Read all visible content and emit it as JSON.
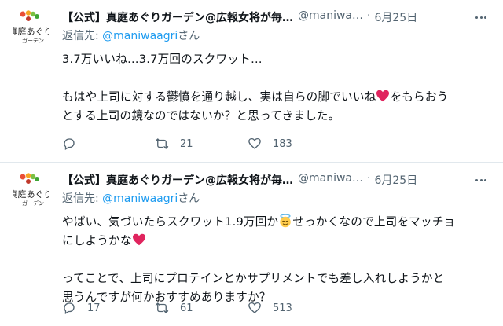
{
  "tweets": [
    {
      "display_name": "【公式】真庭あぐりガーデン@広報女将が毎…",
      "handle": "@maniwa…",
      "separator": "·",
      "date": "6月25日",
      "reply_prefix": "返信先: ",
      "reply_handle": "@maniwaagri",
      "reply_suffix": "さん",
      "line1": "3.7万いいね…3.7万回のスクワット…",
      "line2a": "もはや上司に対する鬱憤を通り越し、実は自らの脚でいいね",
      "line2b": "をもらおう",
      "line3": "とする上司の鏡なのではないか？と思ってきました。",
      "reply_count": "",
      "retweet_count": "21",
      "like_count": "183"
    },
    {
      "display_name": "【公式】真庭あぐりガーデン@広報女将が毎…",
      "handle": "@maniwa…",
      "separator": "·",
      "date": "6月25日",
      "reply_prefix": "返信先: ",
      "reply_handle": "@maniwaagri",
      "reply_suffix": "さん",
      "line1a": "やばい、気づいたらスクワット1.9万回か",
      "line1b": "せっかくなので上司をマッチョ",
      "line2": "にしようかな",
      "line3": "ってことで、上司にプロテインとかサプリメントでも差し入れしようかと",
      "line4": "思うんですが何かおすすめありますか？",
      "reply_count": "17",
      "retweet_count": "61",
      "like_count": "513"
    }
  ],
  "colors": {
    "text": "#0f1419",
    "muted": "#536471",
    "link": "#1d9bf0",
    "heart": "#f91880",
    "divider": "#e1e8ed"
  },
  "icons": [
    "logo-avatar",
    "more-icon",
    "reply-icon",
    "retweet-icon",
    "like-icon",
    "heart-emoji",
    "angel-emoji"
  ]
}
